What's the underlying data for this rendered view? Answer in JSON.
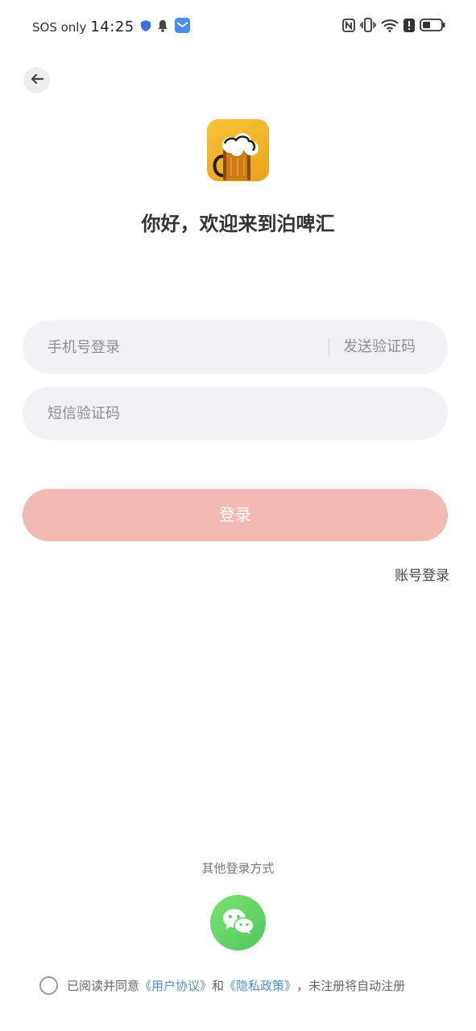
{
  "status_bar": {
    "carrier": "SOS only",
    "time": "14:25",
    "icons": [
      "shield-icon",
      "bell-icon",
      "mail-app-icon",
      "nfc-icon",
      "vibrate-icon",
      "wifi-icon",
      "alert-icon",
      "battery-icon"
    ]
  },
  "header": {
    "back_icon": "arrow-left-icon"
  },
  "brand": {
    "logo_icon": "beer-mug-icon",
    "welcome": "你好，欢迎来到泊啤汇"
  },
  "form": {
    "phone_placeholder": "手机号登录",
    "send_code_label": "发送验证码",
    "sms_code_placeholder": "短信验证码",
    "login_label": "登录",
    "account_login_label": "账号登录"
  },
  "other_login": {
    "title": "其他登录方式",
    "wechat_icon": "wechat-icon"
  },
  "agreement": {
    "text_prefix": "已阅读并同意",
    "user_agreement": "《用户协议》",
    "and": "和",
    "privacy_policy": "《隐私政策》",
    "text_suffix": "，未注册将自动注册"
  },
  "colors": {
    "login_button": "#f3bab4",
    "link": "#4f8fd6",
    "field_bg": "#f1f2f4",
    "wechat": "#5bd164"
  }
}
